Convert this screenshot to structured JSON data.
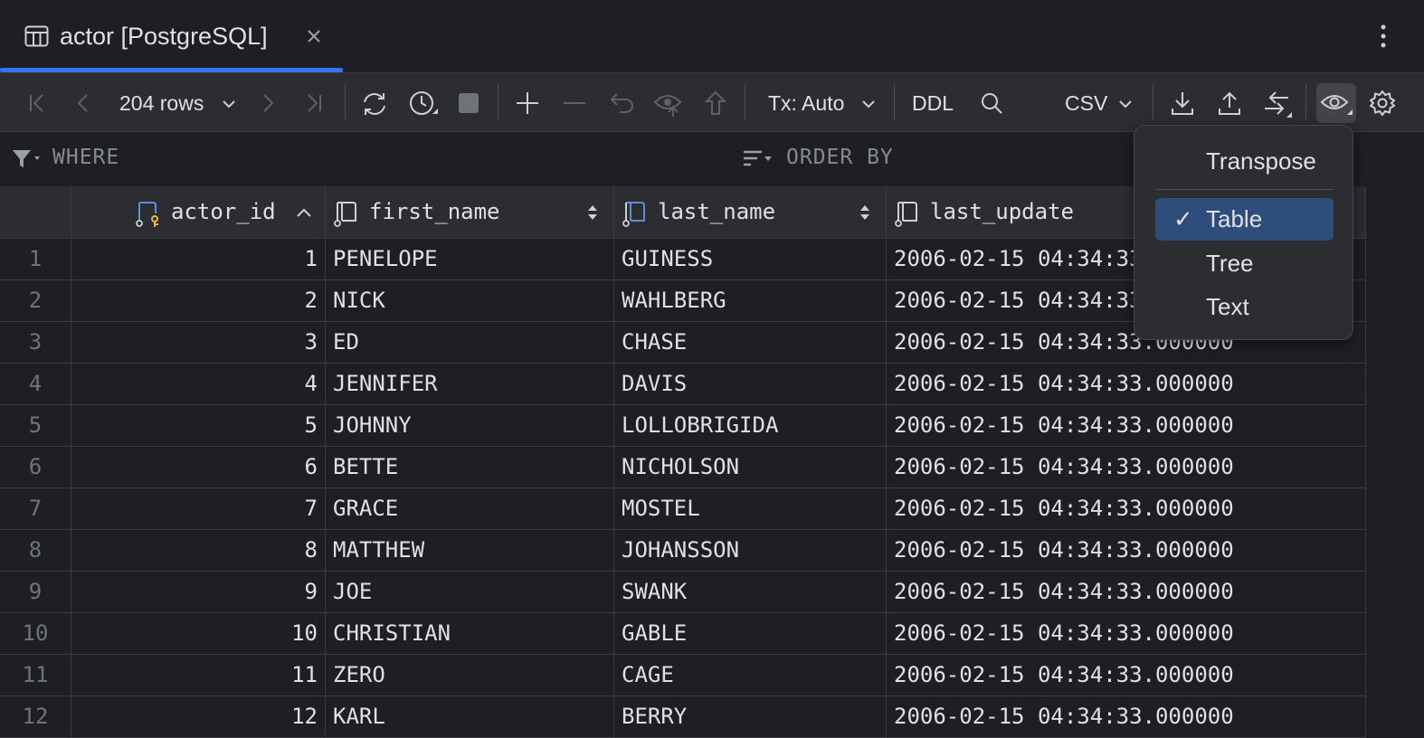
{
  "tab": {
    "title": "actor [PostgreSQL]"
  },
  "toolbar": {
    "rows_label": "204 rows",
    "tx_label": "Tx: Auto",
    "ddl_label": "DDL",
    "export_format": "CSV"
  },
  "filter": {
    "where_label": "WHERE",
    "order_label": "ORDER BY"
  },
  "columns": [
    "actor_id",
    "first_name",
    "last_name",
    "last_update"
  ],
  "rows": [
    {
      "n": "1",
      "id": "1",
      "first": "PENELOPE",
      "last": "GUINESS",
      "updated": "2006-02-15 04:34:33.000000"
    },
    {
      "n": "2",
      "id": "2",
      "first": "NICK",
      "last": "WAHLBERG",
      "updated": "2006-02-15 04:34:33.000000"
    },
    {
      "n": "3",
      "id": "3",
      "first": "ED",
      "last": "CHASE",
      "updated": "2006-02-15 04:34:33.000000"
    },
    {
      "n": "4",
      "id": "4",
      "first": "JENNIFER",
      "last": "DAVIS",
      "updated": "2006-02-15 04:34:33.000000"
    },
    {
      "n": "5",
      "id": "5",
      "first": "JOHNNY",
      "last": "LOLLOBRIGIDA",
      "updated": "2006-02-15 04:34:33.000000"
    },
    {
      "n": "6",
      "id": "6",
      "first": "BETTE",
      "last": "NICHOLSON",
      "updated": "2006-02-15 04:34:33.000000"
    },
    {
      "n": "7",
      "id": "7",
      "first": "GRACE",
      "last": "MOSTEL",
      "updated": "2006-02-15 04:34:33.000000"
    },
    {
      "n": "8",
      "id": "8",
      "first": "MATTHEW",
      "last": "JOHANSSON",
      "updated": "2006-02-15 04:34:33.000000"
    },
    {
      "n": "9",
      "id": "9",
      "first": "JOE",
      "last": "SWANK",
      "updated": "2006-02-15 04:34:33.000000"
    },
    {
      "n": "10",
      "id": "10",
      "first": "CHRISTIAN",
      "last": "GABLE",
      "updated": "2006-02-15 04:34:33.000000"
    },
    {
      "n": "11",
      "id": "11",
      "first": "ZERO",
      "last": "CAGE",
      "updated": "2006-02-15 04:34:33.000000"
    },
    {
      "n": "12",
      "id": "12",
      "first": "KARL",
      "last": "BERRY",
      "updated": "2006-02-15 04:34:33.000000"
    }
  ],
  "view_menu": {
    "transpose_label": "Transpose",
    "items": [
      {
        "label": "Table",
        "selected": true
      },
      {
        "label": "Tree",
        "selected": false
      },
      {
        "label": "Text",
        "selected": false
      }
    ]
  }
}
